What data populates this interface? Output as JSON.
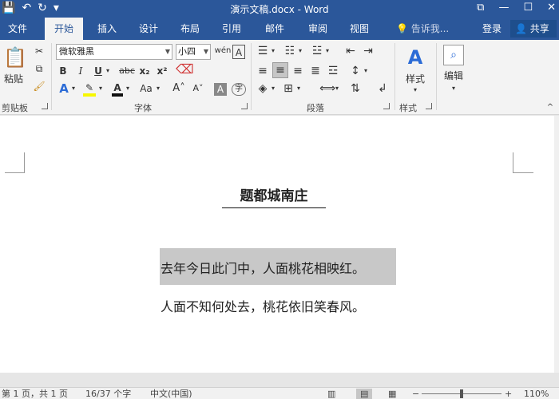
{
  "window": {
    "title": "演示文稿.docx - Word",
    "qat": [
      "💾",
      "↶",
      "↻",
      "▾"
    ],
    "controls": [
      "⧉",
      "—",
      "☐",
      "✕"
    ]
  },
  "tabs": [
    "文件",
    "开始",
    "插入",
    "设计",
    "布局",
    "引用",
    "邮件",
    "审阅",
    "视图"
  ],
  "tellme": "告诉我...",
  "login": "登录",
  "share": "共享",
  "ribbon": {
    "clipboard": {
      "paste_label": "粘贴",
      "group_label": "剪贴板"
    },
    "font": {
      "font_name": "微软雅黑",
      "font_size": "小四",
      "bold": "B",
      "italic": "I",
      "underline": "U",
      "strike": "abc",
      "subscript": "x₂",
      "superscript": "x²",
      "case": "Aa",
      "grow": "A˄",
      "shrink": "A˅",
      "clear": "A",
      "phonetic": "字",
      "group_label": "字体"
    },
    "paragraph": {
      "group_label": "段落"
    },
    "styles": {
      "label": "样式",
      "group_label": "样式"
    },
    "editing": {
      "label": "编辑"
    }
  },
  "document": {
    "title": "题都城南庄",
    "line1": "去年今日此门中，人面桃花相映红。",
    "line2": "人面不知何处去，桃花依旧笑春风。"
  },
  "status": {
    "page": "第 1 页，共 1 页",
    "words": "16/37 个字",
    "language": "中文(中国)",
    "zoom": "110%",
    "zoom_minus": "−",
    "zoom_plus": "+"
  }
}
